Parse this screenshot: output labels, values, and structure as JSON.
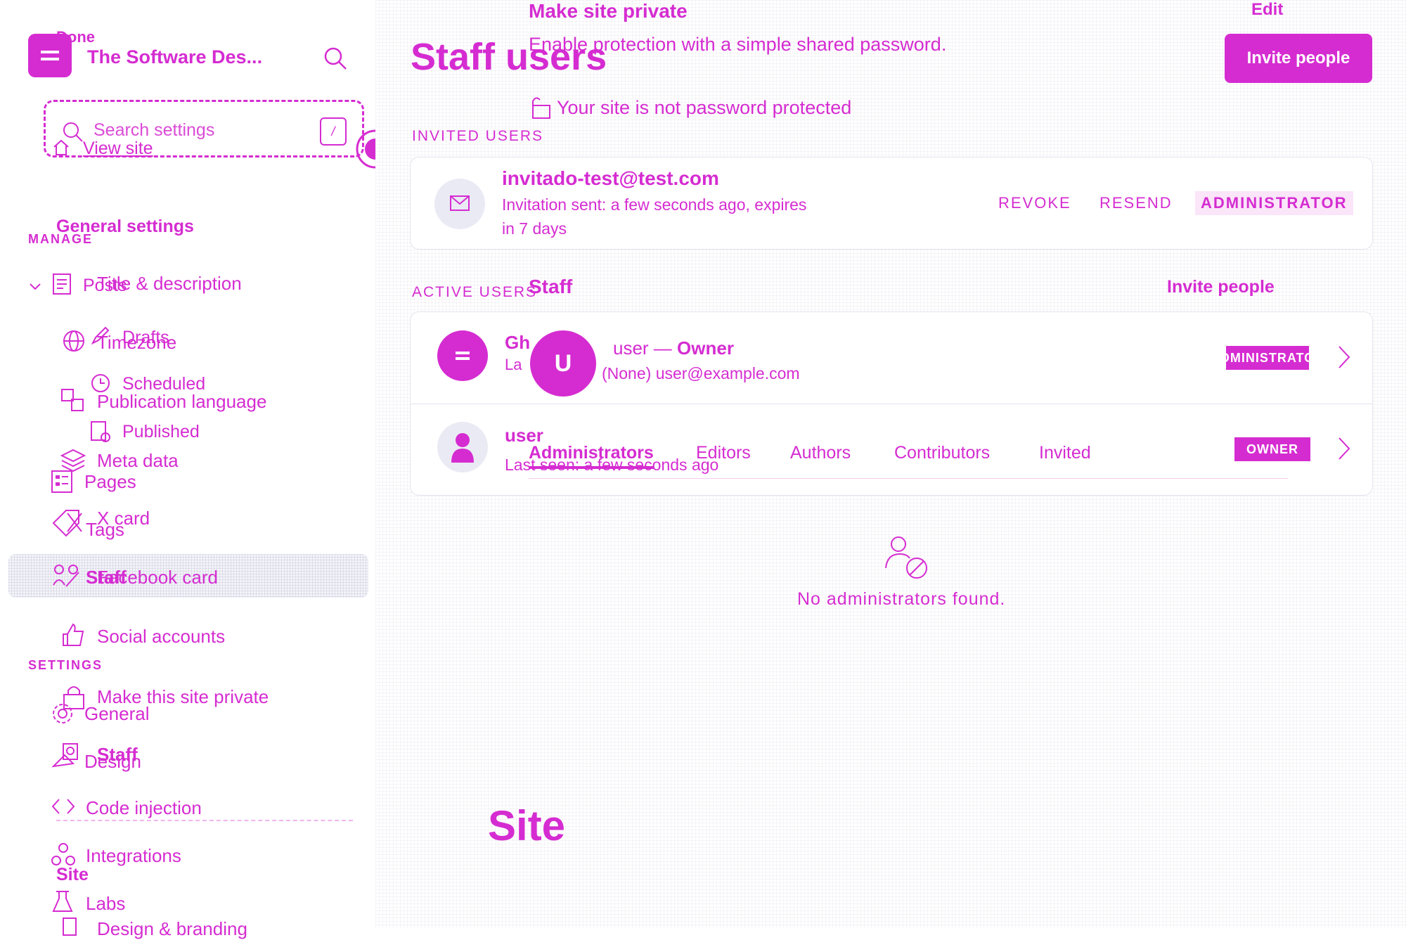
{
  "sidebar": {
    "done_label": "Done",
    "site_name": "The Software Des...",
    "search_placeholder": "Search settings",
    "search_shortcut": "/",
    "view_site": "View site",
    "general_settings": "General settings",
    "manage_label": "MANAGE",
    "posts_label": "Posts",
    "title_description": "Title & description",
    "drafts": "Drafts",
    "timezone": "Timezone",
    "scheduled": "Scheduled",
    "publication_language": "Publication language",
    "published": "Published",
    "meta_data": "Meta data",
    "pages": "Pages",
    "x_card": "X card",
    "tags": "Tags",
    "staff_nav": "Staff",
    "facebook_card": "Facebook card",
    "social_accounts": "Social accounts",
    "settings_label": "SETTINGS",
    "make_private": "Make this site private",
    "general": "General",
    "staff_sub": "Staff",
    "design": "Design",
    "code_injection": "Code injection",
    "integrations": "Integrations",
    "site_heading": "Site",
    "labs": "Labs",
    "design_branding": "Design & branding"
  },
  "overlay": {
    "make_private_title": "Make site private",
    "make_private_desc": "Enable protection with a simple shared password.",
    "edit_label": "Edit",
    "not_protected": "Your site is not password protected",
    "staff_heading": "Staff",
    "invite_people_link": "Invite people",
    "owner_line_prefix": "user — ",
    "owner_line_role": "Owner",
    "owner_email": "(None) user@example.com",
    "tabs": [
      "Administrators",
      "Editors",
      "Authors",
      "Contributors",
      "Invited"
    ],
    "site_big": "Site"
  },
  "main": {
    "page_title": "Staff users",
    "invite_button": "Invite people",
    "invited_label": "INVITED USERS",
    "invited": {
      "email": "invitado-test@test.com",
      "status_line1": "Invitation sent: a few seconds ago, expires",
      "status_line2": "in 7 days",
      "revoke": "REVOKE",
      "resend": "RESEND",
      "role": "ADMINISTRATOR"
    },
    "active_label": "ACTIVE USERS",
    "active_users": [
      {
        "name": "Gh",
        "last_seen": "La",
        "avatar_letter": "U",
        "badge": "ADMINISTRATOR"
      },
      {
        "name": "user",
        "last_seen": "Last seen: a few seconds ago",
        "badge": "OWNER"
      }
    ],
    "empty_text": "No administrators found."
  },
  "colors": {
    "accent": "#d52cd1"
  }
}
